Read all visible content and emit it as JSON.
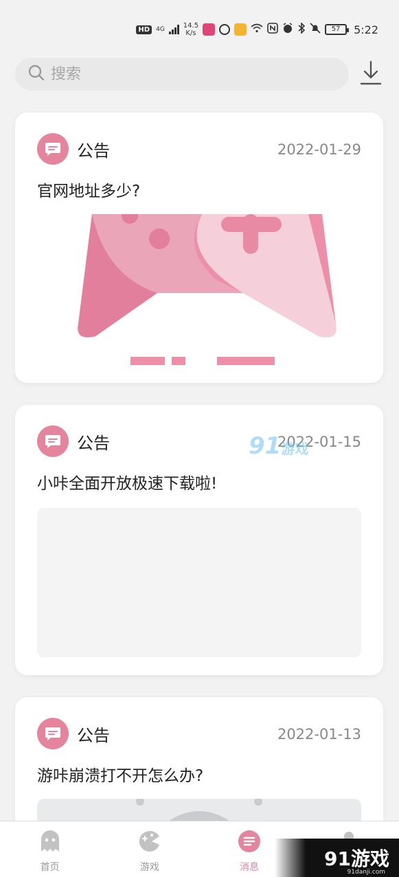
{
  "status_bar": {
    "hd": "HD",
    "network": "4G",
    "speed_value": "14.5",
    "speed_unit": "K/s",
    "battery": "57",
    "time": "5:22"
  },
  "search": {
    "placeholder": "搜索"
  },
  "cards": [
    {
      "type": "公告",
      "date": "2022-01-29",
      "title": "官网地址多少?"
    },
    {
      "type": "公告",
      "date": "2022-01-15",
      "title": "小咔全面开放极速下载啦!"
    },
    {
      "type": "公告",
      "date": "2022-01-13",
      "title": "游咔崩溃打不开怎么办?"
    }
  ],
  "nav": {
    "items": [
      {
        "label": "首页"
      },
      {
        "label": "游戏"
      },
      {
        "label": "消息"
      },
      {
        "label": ""
      }
    ],
    "active_index": 2
  },
  "watermark": {
    "number": "91",
    "text": "游戏",
    "logo": "91游戏",
    "site": "91danji.com"
  },
  "colors": {
    "accent": "#e4849d",
    "background": "#f2f2f2",
    "card": "#ffffff",
    "muted_text": "#888888"
  }
}
